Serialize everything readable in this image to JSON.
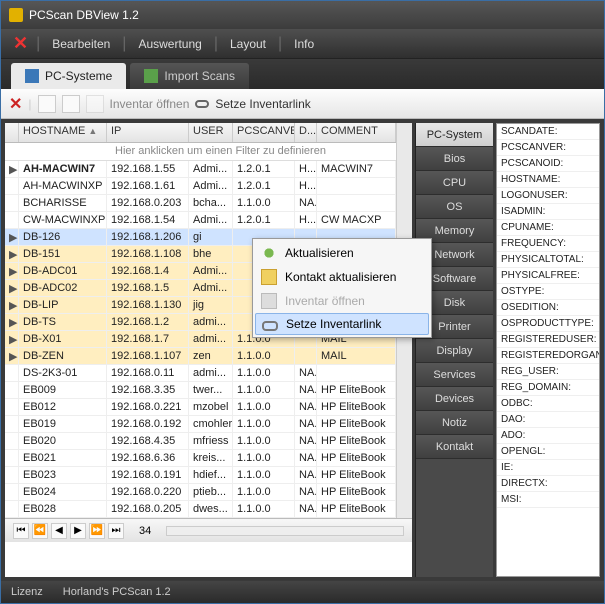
{
  "window": {
    "title": "PCScan DBView 1.2"
  },
  "menu": {
    "items": [
      "Bearbeiten",
      "Auswertung",
      "Layout",
      "Info"
    ]
  },
  "tabbar": {
    "tabs": [
      {
        "label": "PC-Systeme",
        "active": true
      },
      {
        "label": "Import Scans",
        "active": false
      }
    ]
  },
  "toolbar": {
    "inventory_open": "Inventar öffnen",
    "set_link": "Setze Inventarlink"
  },
  "grid": {
    "columns": [
      "HOSTNAME",
      "IP",
      "USER",
      "PCSCANVER",
      "D...",
      "COMMENT"
    ],
    "filter_hint": "Hier anklicken um einen Filter zu definieren",
    "rows": [
      {
        "h": "▶",
        "host": "AH-MACWIN7",
        "bold": true,
        "ip": "192.168.1.55",
        "user": "Admi...",
        "ver": "1.2.0.1",
        "d": "H...",
        "com": "MACWIN7",
        "hl": false
      },
      {
        "h": "",
        "host": "AH-MACWINXP",
        "ip": "192.168.1.61",
        "user": "Admi...",
        "ver": "1.2.0.1",
        "d": "H...",
        "com": "",
        "hl": false
      },
      {
        "h": "",
        "host": "BCHARISSE",
        "ip": "192.168.0.203",
        "user": "bcha...",
        "ver": "1.1.0.0",
        "d": "NA...",
        "com": "",
        "hl": false
      },
      {
        "h": "",
        "host": "CW-MACWINXP",
        "ip": "192.168.1.54",
        "user": "Admi...",
        "ver": "1.2.0.1",
        "d": "H...",
        "com": "CW MACXP",
        "hl": false
      },
      {
        "h": "▶",
        "host": "DB-126",
        "ip": "192.168.1.206",
        "user": "gi",
        "ver": "",
        "d": "",
        "com": "",
        "hl": true,
        "cm": true
      },
      {
        "h": "▶",
        "host": "DB-151",
        "ip": "192.168.1.108",
        "user": "bhe",
        "ver": "",
        "d": "",
        "com": "",
        "hl": true
      },
      {
        "h": "▶",
        "host": "DB-ADC01",
        "ip": "192.168.1.4",
        "user": "Admi...",
        "ver": "",
        "d": "",
        "com": "",
        "hl": true
      },
      {
        "h": "▶",
        "host": "DB-ADC02",
        "ip": "192.168.1.5",
        "user": "Admi...",
        "ver": "",
        "d": "",
        "com": "",
        "hl": true
      },
      {
        "h": "▶",
        "host": "DB-LIP",
        "ip": "192.168.1.130",
        "user": "jig",
        "ver": "",
        "d": "",
        "com": "",
        "hl": true
      },
      {
        "h": "▶",
        "host": "DB-TS",
        "ip": "192.168.1.2",
        "user": "admi...",
        "ver": "",
        "d": "",
        "com": "",
        "hl": true
      },
      {
        "h": "▶",
        "host": "DB-X01",
        "ip": "192.168.1.7",
        "user": "admi...",
        "ver": "1.1.0.0",
        "d": "",
        "com": "MAIL",
        "hl": true
      },
      {
        "h": "▶",
        "host": "DB-ZEN",
        "ip": "192.168.1.107",
        "user": "zen",
        "ver": "1.1.0.0",
        "d": "",
        "com": "MAIL",
        "hl": true
      },
      {
        "h": "",
        "host": "DS-2K3-01",
        "ip": "192.168.0.11",
        "user": "admi...",
        "ver": "1.1.0.0",
        "d": "NA...",
        "com": "",
        "hl": false
      },
      {
        "h": "",
        "host": "EB009",
        "ip": "192.168.3.35",
        "user": "twer...",
        "ver": "1.1.0.0",
        "d": "NA...",
        "com": "HP EliteBook",
        "hl": false
      },
      {
        "h": "",
        "host": "EB012",
        "ip": "192.168.0.221",
        "user": "mzobel",
        "ver": "1.1.0.0",
        "d": "NA...",
        "com": "HP EliteBook",
        "hl": false
      },
      {
        "h": "",
        "host": "EB019",
        "ip": "192.168.0.192",
        "user": "cmohler",
        "ver": "1.1.0.0",
        "d": "NA...",
        "com": "HP EliteBook",
        "hl": false
      },
      {
        "h": "",
        "host": "EB020",
        "ip": "192.168.4.35",
        "user": "mfriess",
        "ver": "1.1.0.0",
        "d": "NA...",
        "com": "HP EliteBook",
        "hl": false
      },
      {
        "h": "",
        "host": "EB021",
        "ip": "192.168.6.36",
        "user": "kreis...",
        "ver": "1.1.0.0",
        "d": "NA...",
        "com": "HP EliteBook",
        "hl": false
      },
      {
        "h": "",
        "host": "EB023",
        "ip": "192.168.0.191",
        "user": "hdief...",
        "ver": "1.1.0.0",
        "d": "NA...",
        "com": "HP EliteBook",
        "hl": false
      },
      {
        "h": "",
        "host": "EB024",
        "ip": "192.168.0.220",
        "user": "ptieb...",
        "ver": "1.1.0.0",
        "d": "NA...",
        "com": "HP EliteBook",
        "hl": false
      },
      {
        "h": "",
        "host": "EB028",
        "ip": "192.168.0.205",
        "user": "dwes...",
        "ver": "1.1.0.0",
        "d": "NA...",
        "com": "HP EliteBook",
        "hl": false
      }
    ],
    "count": "34"
  },
  "context": {
    "items": [
      {
        "label": "Aktualisieren",
        "icon": "refresh",
        "disabled": false,
        "sel": false
      },
      {
        "label": "Kontakt aktualisieren",
        "icon": "contact",
        "disabled": false,
        "sel": false
      },
      {
        "label": "Inventar öffnen",
        "icon": "inv",
        "disabled": true,
        "sel": false
      },
      {
        "label": "Setze Inventarlink",
        "icon": "link",
        "disabled": false,
        "sel": true
      }
    ]
  },
  "sidetabs": [
    "PC-System",
    "Bios",
    "CPU",
    "OS",
    "Memory",
    "Network",
    "Software",
    "Disk",
    "Printer",
    "Display",
    "Services",
    "Devices",
    "Notiz",
    "Kontakt"
  ],
  "sidetab_active": 0,
  "props": [
    "SCANDATE:",
    "PCSCANVER:",
    "PCSCANOID:",
    "HOSTNAME:",
    "LOGONUSER:",
    "ISADMIN:",
    "CPUNAME:",
    "FREQUENCY:",
    "PHYSICALTOTAL:",
    "PHYSICALFREE:",
    "OSTYPE:",
    "OSEDITION:",
    "OSPRODUCTTYPE:",
    "REGISTEREDUSER:",
    "REGISTEREDORGAN",
    "REG_USER:",
    "REG_DOMAIN:",
    "ODBC:",
    "DAO:",
    "ADO:",
    "OPENGL:",
    "IE:",
    "DIRECTX:",
    "MSI:"
  ],
  "status": {
    "left": "Lizenz",
    "right": "Horland's PCScan 1.2"
  }
}
